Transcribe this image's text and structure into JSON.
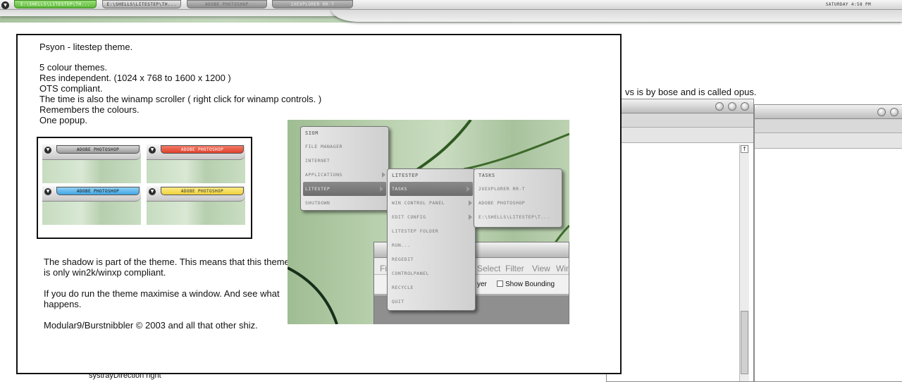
{
  "taskbar": {
    "menu_icon": "chevron-down-icon",
    "tasks": [
      {
        "label": "E:\\SHELLS\\LITESTEP\\TH...",
        "state": "active"
      },
      {
        "label": "E:\\SHELLS\\LITESTEP\\TH...",
        "state": "normal"
      },
      {
        "label": "ADOBE PHOTOSHOP",
        "state": "minimized"
      },
      {
        "label": "2XEXPLORER RR-T",
        "state": "normal"
      }
    ],
    "clock": "SATURDAY 4:58 PM"
  },
  "background": {
    "page_text": "vs is by bose and is called opus.",
    "systray_text": "systrayDirection right",
    "scroll_up_glyph": "↑"
  },
  "main": {
    "title_line": "Psyon - litestep theme.",
    "features": [
      "5 colour themes.",
      "Res independent. (1024 x 768 to 1600 x 1200 )",
      "OTS compliant.",
      "The time is also the winamp scroller ( right click for winamp controls. )",
      "Remembers the colours.",
      "One popup."
    ],
    "notes": [
      "The shadow is part of the theme. This means that this theme is only win2k/winxp compliant.",
      "If you do run the theme maximise a window. And see what happens.",
      "Modular9/Burstnibbler © 2003 and all that other shiz."
    ],
    "colour_previews": [
      {
        "label": "ADOBE PHOTOSHOP",
        "color": "#9a9a9a",
        "text_color": "#111111"
      },
      {
        "label": "ADOBE PHOTOSHOP",
        "color": "#e0412c",
        "text_color": "#ffffff"
      },
      {
        "label": "ADOBE PHOTOSHOP",
        "color": "#3fa6e4",
        "text_color": "#111111"
      },
      {
        "label": "ADOBE PHOTOSHOP",
        "color": "#f0d23a",
        "text_color": "#333333"
      }
    ]
  },
  "screenshot": {
    "menu_main": {
      "title": "SIOM",
      "items": [
        "FILE MANAGER",
        "INTERNET",
        "APPLICATIONS",
        "LITESTEP",
        "SHUTDOWN"
      ]
    },
    "menu_litestep": {
      "title": "LITESTEP",
      "items": [
        "TASKS",
        "WIN CONTROL PANEL",
        "EDIT CONFIG",
        "LITESTEP FOLDER",
        "RUN...",
        "REGEDIT",
        "CONTROLPANEL",
        "RECYCLE",
        "QUIT"
      ]
    },
    "menu_tasks": {
      "title": "TASKS",
      "items": [
        "2XEXPLORER RR-T",
        "ADOBE PHOTOSHOP",
        "E:\\SHELLS\\LITESTEP\\T..."
      ]
    },
    "app_menu": [
      "Fi",
      "Select",
      "Filter",
      "View",
      "Win"
    ],
    "app_toolbar": {
      "layer_text": "yer",
      "checkbox_label": "Show Bounding Box"
    }
  }
}
